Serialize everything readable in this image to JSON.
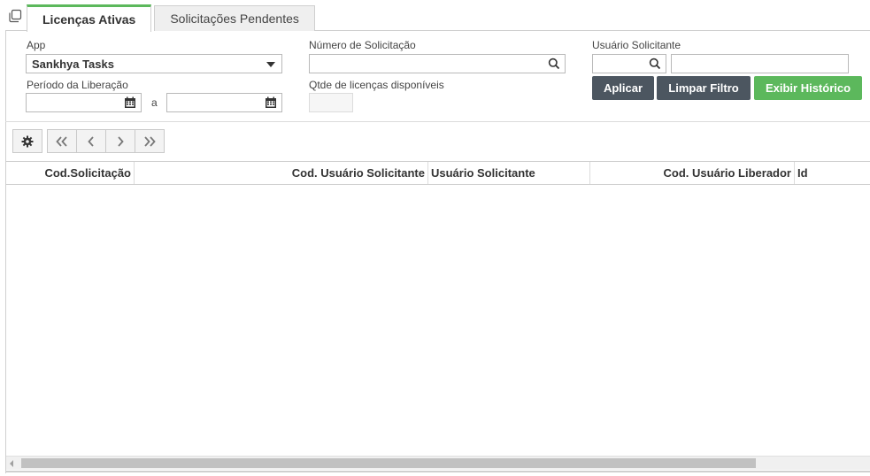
{
  "tabs": [
    {
      "label": "Licenças Ativas",
      "active": true
    },
    {
      "label": "Solicitações Pendentes",
      "active": false
    }
  ],
  "filters": {
    "app_label": "App",
    "app_value": "Sankhya Tasks",
    "numero_label": "Número de Solicitação",
    "numero_value": "",
    "usuario_label": "Usuário Solicitante",
    "usuario_code": "",
    "usuario_name": "",
    "periodo_label": "Período da Liberação",
    "periodo_from": "",
    "periodo_sep": "a",
    "periodo_to": "",
    "qtde_label": "Qtde de licenças disponíveis",
    "qtde_value": ""
  },
  "buttons": {
    "apply": "Aplicar",
    "clear": "Limpar Filtro",
    "history": "Exibir Histórico"
  },
  "colors": {
    "tab_accent": "#5cb85c",
    "button_dark": "#4c5660",
    "button_green": "#5cb85c"
  },
  "grid": {
    "columns": [
      "Cod.Solicitação",
      "Cod. Usuário Solicitante",
      "Usuário Solicitante",
      "Cod. Usuário Liberador",
      "Id"
    ],
    "rows": []
  },
  "icons": [
    "window-copy-icon",
    "search-icon",
    "calendar-icon",
    "gear-icon",
    "first-page-icon",
    "prev-page-icon",
    "next-page-icon",
    "last-page-icon"
  ]
}
